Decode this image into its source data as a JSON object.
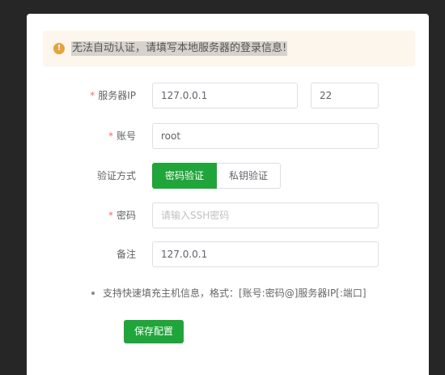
{
  "alert": {
    "icon": "warning-icon",
    "text": "无法自动认证，请填写本地服务器的登录信息!"
  },
  "form": {
    "server": {
      "label": "服务器IP",
      "host_value": "127.0.0.1",
      "port_value": "22"
    },
    "account": {
      "label": "账号",
      "value": "root"
    },
    "auth": {
      "label": "验证方式",
      "options": [
        "密码验证",
        "私钥验证"
      ],
      "selected": "密码验证"
    },
    "password": {
      "label": "密码",
      "placeholder": "请输入SSH密码"
    },
    "remark": {
      "label": "备注",
      "value": "127.0.0.1"
    }
  },
  "tip": "支持快速填充主机信息，格式：[账号:密码@]服务器IP[:端口]",
  "save_button": "保存配置",
  "colors": {
    "primary": "#20a53a",
    "warning": "#e6a23c",
    "required": "#f56c6c"
  }
}
